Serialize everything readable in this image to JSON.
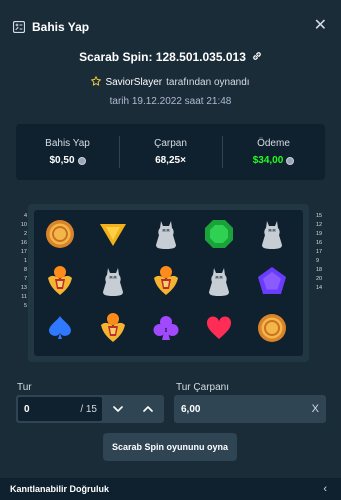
{
  "header": {
    "title": "Bahis Yap",
    "close_glyph": "✕"
  },
  "spin": {
    "label": "Scarab Spin: 128.501.035.013",
    "link_icon": "link-icon"
  },
  "played": {
    "player": "SaviorSlayer",
    "suffix": "tarafından oynandı"
  },
  "date": "tarih 19.12.2022 saat 21:48",
  "stats": [
    {
      "label": "Bahis Yap",
      "value": "$0,50",
      "coin": true
    },
    {
      "label": "Çarpan",
      "value": "68,25×",
      "coin": false
    },
    {
      "label": "Ödeme",
      "value": "$34,00",
      "coin": true,
      "color": "#1fff20"
    }
  ],
  "paylines": {
    "left": [
      "4",
      "10",
      "2",
      "16",
      "",
      "17",
      "1",
      "8",
      "",
      "7",
      "13",
      "11",
      "5"
    ],
    "right": [
      "15",
      "12",
      "19",
      "",
      "16",
      "17",
      "9",
      "",
      "18",
      "20",
      "",
      "14"
    ]
  },
  "reels": [
    [
      "coin",
      "scarab",
      "spade"
    ],
    [
      "triangle",
      "cat",
      "scarab"
    ],
    [
      "cat",
      "scarab",
      "club"
    ],
    [
      "emerald",
      "cat",
      "heart"
    ],
    [
      "cat",
      "pentagon",
      "coin"
    ]
  ],
  "tur": {
    "label": "Tur",
    "value": "0",
    "of": "/ 15"
  },
  "multiplier": {
    "label": "Tur Çarpanı",
    "value": "6,00",
    "clear": "X"
  },
  "cta": {
    "label": "Scarab Spin oyununu oyna"
  },
  "footer": {
    "label": "Kanıtlanabilir Doğruluk",
    "chevron": "‹"
  },
  "colors": {
    "bg": "#1a2c38",
    "panel": "#0f212e",
    "border": "#2f4553",
    "win": "#1fff20"
  }
}
